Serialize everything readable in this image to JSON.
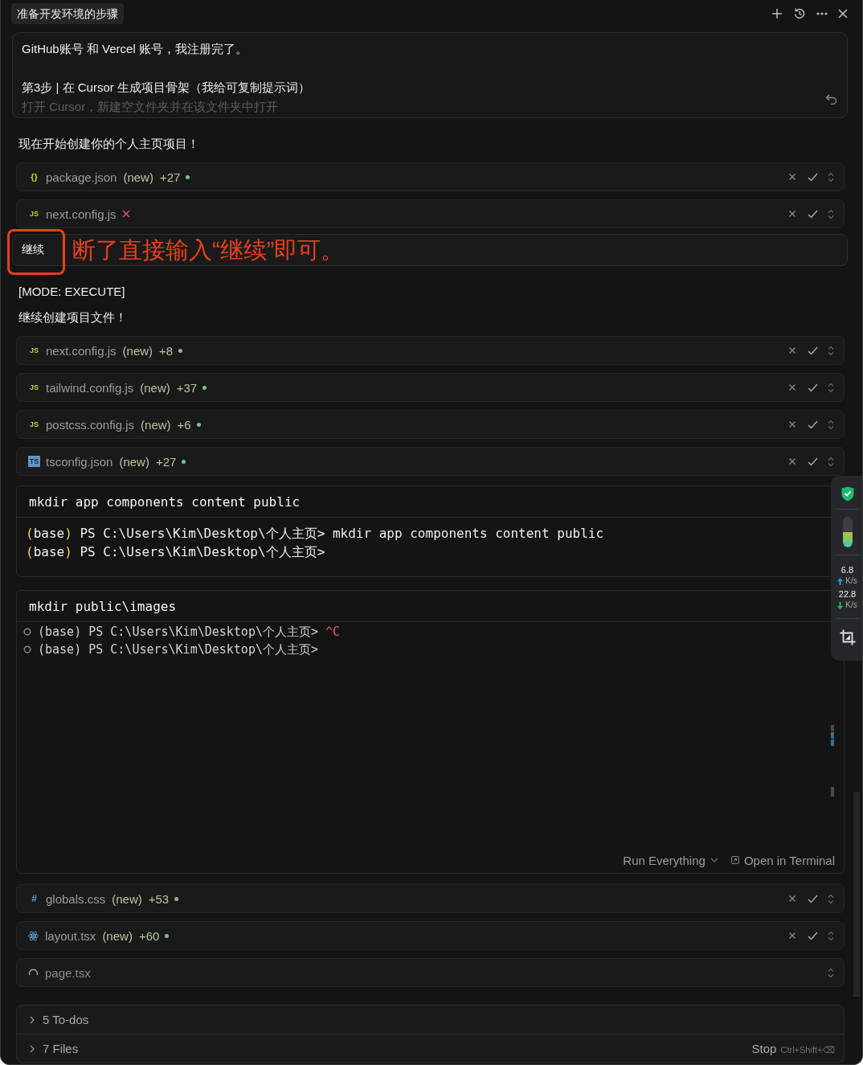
{
  "header": {
    "title": "准备开发环境的步骤"
  },
  "message": {
    "paragraphs": [
      {
        "lines": [
          {
            "text": "GitHub账号 和 Vercel 账号，我注册完了。",
            "faded": false
          }
        ]
      },
      {
        "lines": [
          {
            "text": "第3步 | 在 Cursor 生成项目骨架（我给可复制提示词）",
            "faded": false
          },
          {
            "text": "打开 Cursor，新建空文件夹并在该文件夹中打开",
            "faded": true
          }
        ]
      }
    ]
  },
  "feed": [
    {
      "kind": "text",
      "text": "现在开始创建你的个人主页项目！"
    },
    {
      "kind": "file",
      "badge": {
        "kind": "braces",
        "label": "{}"
      },
      "name": "package.json",
      "failed": false,
      "pending": false,
      "tag": "(new)",
      "added": "+27"
    },
    {
      "kind": "file",
      "badge": {
        "kind": "letters",
        "label": "JS"
      },
      "name": "next.config.js",
      "failed": true,
      "pending": false
    },
    {
      "kind": "user",
      "text": "继续",
      "callout": "断了直接输入“继续”即可。"
    },
    {
      "kind": "text",
      "text": "[MODE: EXECUTE]"
    },
    {
      "kind": "text",
      "text": "继续创建项目文件！"
    },
    {
      "kind": "file",
      "badge": {
        "kind": "letters",
        "label": "JS"
      },
      "name": "next.config.js",
      "failed": false,
      "pending": false,
      "tag": "(new)",
      "added": "+8"
    },
    {
      "kind": "file",
      "badge": {
        "kind": "letters",
        "label": "JS"
      },
      "name": "tailwind.config.js",
      "failed": false,
      "pending": false,
      "tag": "(new)",
      "added": "+37"
    },
    {
      "kind": "file",
      "badge": {
        "kind": "letters",
        "label": "JS"
      },
      "name": "postcss.config.js",
      "failed": false,
      "pending": false,
      "tag": "(new)",
      "added": "+6"
    },
    {
      "kind": "file",
      "badge": {
        "kind": "tile",
        "label": "TS"
      },
      "name": "tsconfig.json",
      "failed": false,
      "pending": false,
      "tag": "(new)",
      "added": "+27"
    },
    {
      "kind": "terminal",
      "command": "mkdir app components content public",
      "line_markers": false,
      "lines": [
        [
          {
            "text": "(",
            "kind": "bracket"
          },
          {
            "text": "base",
            "kind": "plain"
          },
          {
            "text": ")",
            "kind": "bracket"
          },
          {
            "text": " PS C:\\Users\\Kim\\Desktop\\个人主页> mkdir app components content public",
            "kind": "plain"
          }
        ],
        [
          {
            "text": "(",
            "kind": "bracket"
          },
          {
            "text": "base",
            "kind": "plain"
          },
          {
            "text": ")",
            "kind": "bracket"
          },
          {
            "text": " PS C:\\Users\\Kim\\Desktop\\个人主页>",
            "kind": "plain"
          }
        ]
      ]
    },
    {
      "kind": "terminal",
      "command": "mkdir public\\images",
      "line_markers": true,
      "lines": [
        [
          {
            "text": "(base) PS C:\\Users\\Kim\\Desktop\\个人主页> ",
            "kind": "dim"
          },
          {
            "text": "^C",
            "kind": "interrupt"
          }
        ],
        [
          {
            "text": "(base) PS C:\\Users\\Kim\\Desktop\\个人主页>",
            "kind": "dim"
          }
        ]
      ],
      "actions": [
        {
          "kind": "dropdown",
          "label": "Run Everything"
        },
        {
          "kind": "external",
          "label": "Open in Terminal"
        }
      ]
    },
    {
      "kind": "file",
      "badge": {
        "kind": "hash",
        "label": "#"
      },
      "name": "globals.css",
      "failed": false,
      "pending": false,
      "tag": "(new)",
      "added": "+53"
    },
    {
      "kind": "file",
      "badge": {
        "kind": "atom"
      },
      "name": "layout.tsx",
      "failed": false,
      "pending": false,
      "tag": "(new)",
      "added": "+60"
    },
    {
      "kind": "file",
      "badge": {
        "kind": "spinner"
      },
      "name": "page.tsx",
      "failed": false,
      "pending": true
    }
  ],
  "summary": {
    "rows": [
      {
        "label": "5 To-dos",
        "expanded": false
      },
      {
        "label": "7 Files",
        "expanded": false,
        "stop": {
          "label": "Stop",
          "shortcut": "Ctrl+Shift+⌫"
        }
      }
    ]
  },
  "monitor": {
    "meter": {
      "level": 0.5
    },
    "upload": {
      "value": "6.8",
      "unit": "K/s"
    },
    "download": {
      "value": "22.8",
      "unit": "K/s"
    }
  }
}
